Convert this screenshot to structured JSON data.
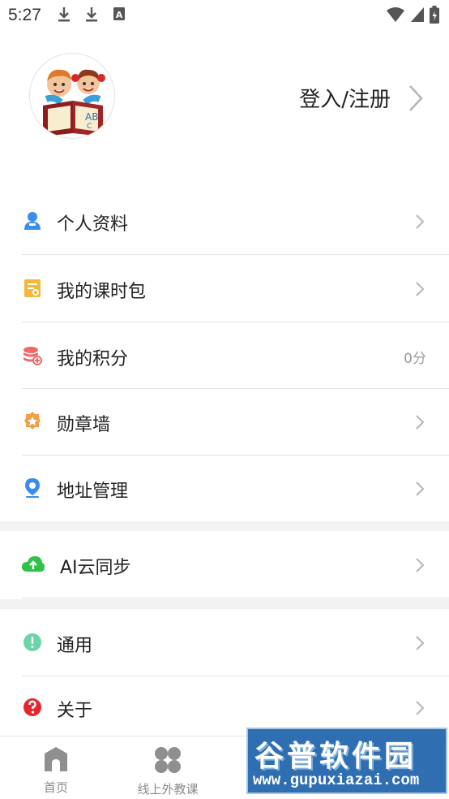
{
  "status_bar": {
    "time": "5:27",
    "icons": [
      "download-icon",
      "download-icon",
      "font-a-icon",
      "wifi-icon",
      "signal-icon",
      "battery-charging-icon"
    ]
  },
  "profile": {
    "login_label": "登入/注册"
  },
  "menu_group_1": [
    {
      "label": "个人资料",
      "icon": "user-icon",
      "color": "#3b8de8"
    },
    {
      "label": "我的课时包",
      "icon": "course-package-icon",
      "color": "#f5b83a"
    },
    {
      "label": "我的积分",
      "icon": "points-coins-icon",
      "color": "#ef6767",
      "value": "0分"
    },
    {
      "label": "勋章墙",
      "icon": "medal-icon",
      "color": "#f0a048"
    },
    {
      "label": "地址管理",
      "icon": "location-pin-icon",
      "color": "#3b8de8"
    }
  ],
  "menu_group_2": [
    {
      "label": "AI云同步",
      "icon": "cloud-upload-icon",
      "color": "#2fc24a"
    }
  ],
  "menu_group_3": [
    {
      "label": "通用",
      "icon": "info-circle-icon",
      "color": "#6dd3a8"
    },
    {
      "label": "关于",
      "icon": "question-circle-icon",
      "color": "#e5252a"
    }
  ],
  "bottom_nav": [
    {
      "label": "首页",
      "icon": "home-icon"
    },
    {
      "label": "线上外教课",
      "icon": "clover-grid-icon"
    }
  ],
  "watermark": {
    "title": "谷普软件园",
    "url": "www.gupuxiazai.com"
  }
}
